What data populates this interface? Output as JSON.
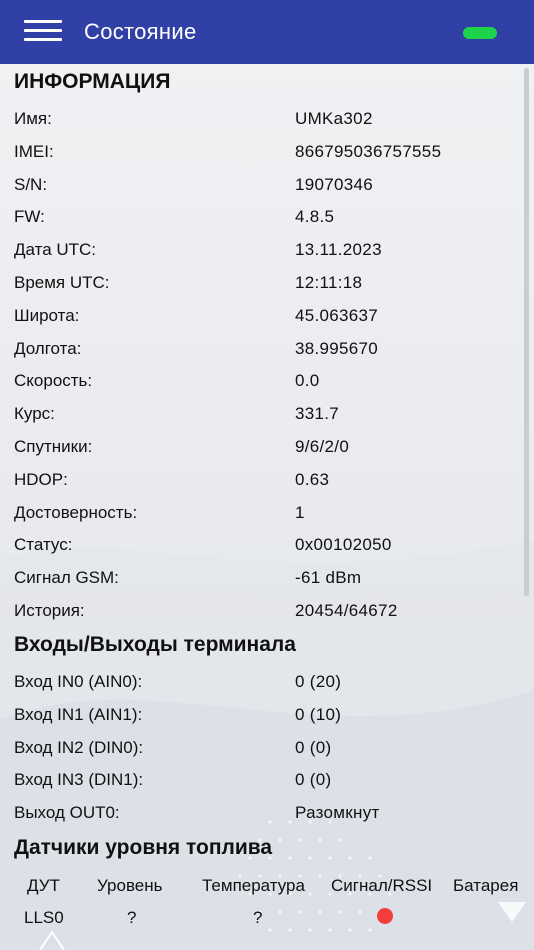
{
  "header": {
    "title": "Состояние",
    "status_color": "#1ed34a",
    "menu_icon": "hamburger-menu-icon"
  },
  "info": {
    "title": "ИНФОРМАЦИЯ",
    "rows": [
      {
        "label": "Имя:",
        "value": "UMKa302"
      },
      {
        "label": "IMEI:",
        "value": "866795036757555"
      },
      {
        "label": "S/N:",
        "value": "19070346"
      },
      {
        "label": "FW:",
        "value": "4.8.5"
      },
      {
        "label": "Дата UTC:",
        "value": "13.11.2023"
      },
      {
        "label": "Время UTC:",
        "value": "12:11:18"
      },
      {
        "label": "Широта:",
        "value": "45.063637"
      },
      {
        "label": "Долгота:",
        "value": "38.995670"
      },
      {
        "label": "Скорость:",
        "value": "0.0"
      },
      {
        "label": "Курс:",
        "value": "331.7"
      },
      {
        "label": "Спутники:",
        "value": "9/6/2/0"
      },
      {
        "label": "HDOP:",
        "value": "0.63"
      },
      {
        "label": "Достоверность:",
        "value": "1"
      },
      {
        "label": "Статус:",
        "value": "0x00102050"
      },
      {
        "label": "Сигнал GSM:",
        "value": "-61 dBm"
      },
      {
        "label": "История:",
        "value": "20454/64672"
      }
    ]
  },
  "io": {
    "title": "Входы/Выходы терминала",
    "rows": [
      {
        "label": "Вход IN0 (AIN0):",
        "value": "0 (20)"
      },
      {
        "label": "Вход IN1 (AIN1):",
        "value": "0 (10)"
      },
      {
        "label": "Вход IN2 (DIN0):",
        "value": "0 (0)"
      },
      {
        "label": "Вход IN3 (DIN1):",
        "value": "0 (0)"
      },
      {
        "label": "Выход OUT0:",
        "value": "Разомкнут"
      }
    ]
  },
  "fuel": {
    "title": "Датчики уровня топлива",
    "columns": [
      "ДУТ",
      "Уровень",
      "Температура",
      "Сигнал/RSSI",
      "Батарея"
    ],
    "rows": [
      {
        "sensor": "LLS0",
        "level": "?",
        "temperature": "?",
        "signal_color": "#f43d3d",
        "battery": ""
      }
    ]
  }
}
